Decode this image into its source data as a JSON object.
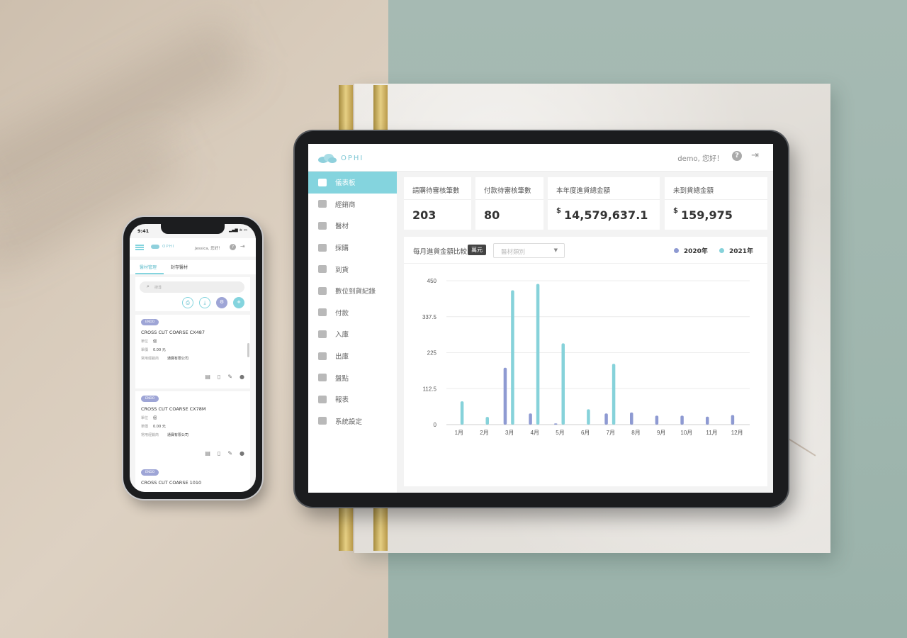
{
  "tablet": {
    "brand": "OPHI",
    "greeting": "demo, 您好！",
    "help_icon": "question-circle-icon",
    "logout_icon": "logout-icon",
    "sidebar": {
      "items": [
        {
          "label": "儀表板",
          "icon": "dashboard-icon",
          "active": true
        },
        {
          "label": "經銷商",
          "icon": "user-icon"
        },
        {
          "label": "醫材",
          "icon": "box-icon"
        },
        {
          "label": "採購",
          "icon": "cart-icon"
        },
        {
          "label": "到貨",
          "icon": "delivery-icon"
        },
        {
          "label": "數位到貨紀錄",
          "icon": "digital-delivery-icon"
        },
        {
          "label": "付款",
          "icon": "dollar-icon"
        },
        {
          "label": "入庫",
          "icon": "inbound-icon"
        },
        {
          "label": "出庫",
          "icon": "outbound-icon"
        },
        {
          "label": "盤點",
          "icon": "checklist-icon"
        },
        {
          "label": "報表",
          "icon": "report-icon"
        },
        {
          "label": "系統設定",
          "icon": "gear-icon"
        }
      ]
    },
    "stats": [
      {
        "label": "請購待審核筆數",
        "value": "203",
        "currency": ""
      },
      {
        "label": "付款待審核筆數",
        "value": "80",
        "currency": ""
      },
      {
        "label": "本年度進貨總金額",
        "value": "14,579,637.1",
        "currency": "$"
      },
      {
        "label": "未到貨總金額",
        "value": "159,975",
        "currency": "$"
      }
    ],
    "chart_header": {
      "title": "每月進貨金額比較",
      "unit_badge": "萬元",
      "select_placeholder": "醫材類別"
    }
  },
  "chart_data": {
    "type": "bar",
    "categories": [
      "1月",
      "2月",
      "3月",
      "4月",
      "5月",
      "6月",
      "7月",
      "8月",
      "9月",
      "10月",
      "11月",
      "12月"
    ],
    "series": [
      {
        "name": "2020年",
        "color": "#8e9ad2",
        "values": [
          0,
          0,
          178,
          35,
          4,
          0,
          35,
          38,
          28,
          28,
          25,
          30
        ]
      },
      {
        "name": "2021年",
        "color": "#86d2da",
        "values": [
          73,
          24,
          420,
          440,
          254,
          48,
          190,
          0,
          0,
          0,
          0,
          0
        ]
      }
    ],
    "yticks": [
      "0",
      "112.5",
      "225",
      "337.5",
      "450"
    ],
    "ylim": [
      0,
      450
    ],
    "grid": true,
    "legend": "top-right"
  },
  "phone": {
    "time": "9:41",
    "status_icons": "▂▄▆ ≋ ▭",
    "brand": "OPHI",
    "greeting": "Jessica, 您好！",
    "tabs": [
      "醫材管理",
      "封存醫材"
    ],
    "search_placeholder": "搜尋",
    "toolbar_icons": [
      "print-icon",
      "download-icon",
      "settings-icon",
      "add-icon"
    ],
    "items": [
      {
        "badge": "ENDO",
        "name": "CROSS CUT COARSE CX487",
        "unit_label": "單位",
        "unit": "個",
        "price_label": "單價",
        "price": "0.00 元",
        "dealer_label": "常用經銷商",
        "dealer": "通寶有限公司"
      },
      {
        "badge": "ENDO",
        "name": "CROSS CUT COARSE CX78M",
        "unit_label": "單位",
        "unit": "個",
        "price_label": "單價",
        "price": "0.00 元",
        "dealer_label": "常用經銷商",
        "dealer": "通寶有限公司"
      },
      {
        "badge": "ENDO",
        "name": "CROSS CUT COARSE 1010"
      }
    ]
  },
  "colors": {
    "accent": "#84d4de",
    "series_2020": "#8e9ad2",
    "series_2021": "#86d2da"
  }
}
